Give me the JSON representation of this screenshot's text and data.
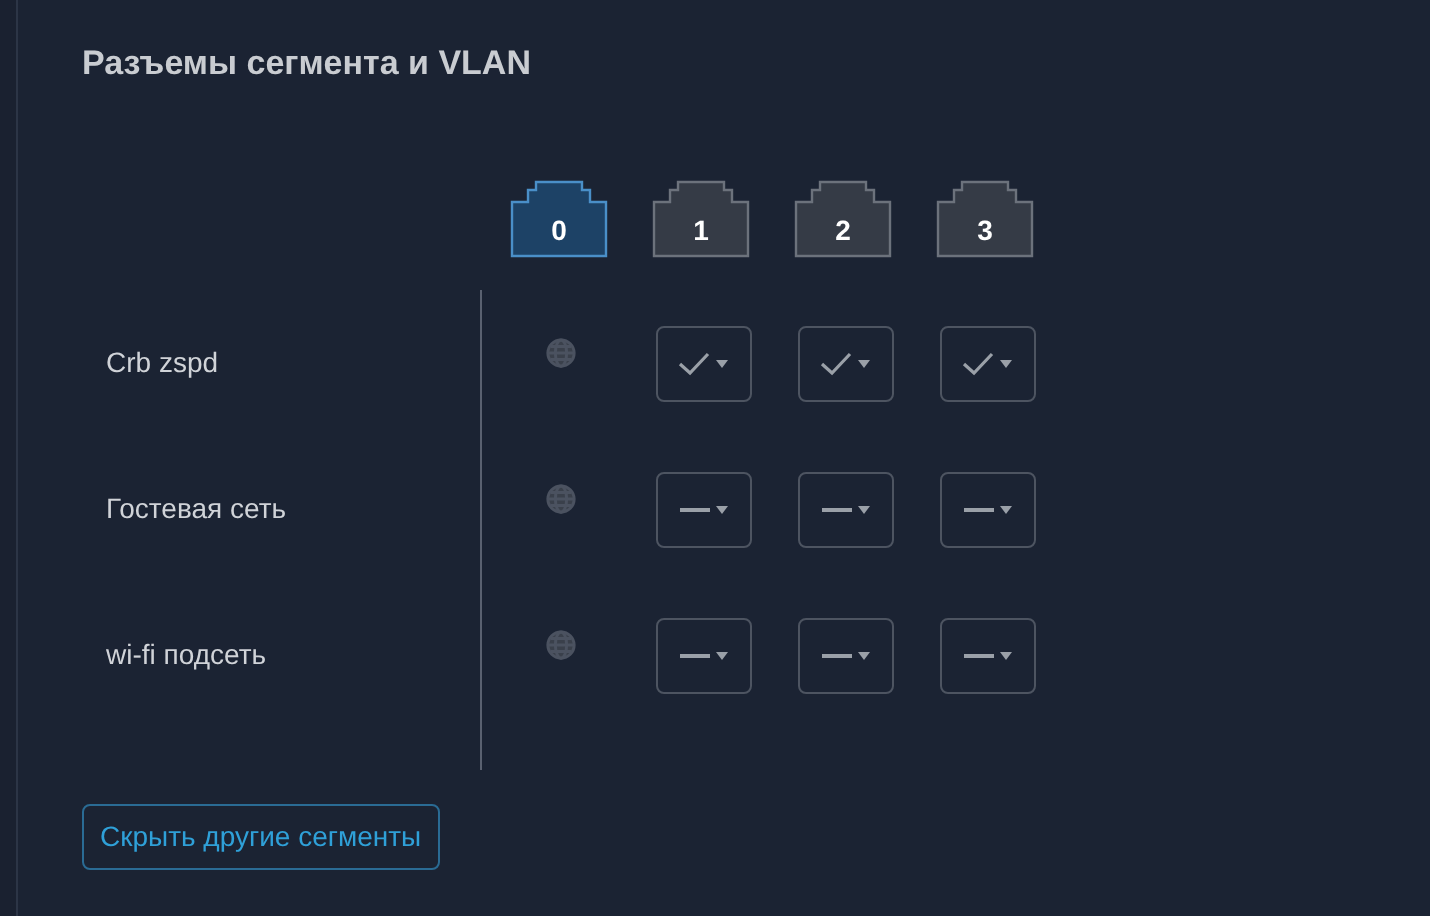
{
  "title": "Разъемы сегмента и VLAN",
  "ports": [
    {
      "label": "0",
      "selected": true
    },
    {
      "label": "1",
      "selected": false
    },
    {
      "label": "2",
      "selected": false
    },
    {
      "label": "3",
      "selected": false
    }
  ],
  "segments": [
    {
      "name": "Crb zspd",
      "cells": [
        {
          "kind": "globe"
        },
        {
          "kind": "check"
        },
        {
          "kind": "check"
        },
        {
          "kind": "check"
        }
      ]
    },
    {
      "name": "Гостевая сеть",
      "cells": [
        {
          "kind": "globe"
        },
        {
          "kind": "none"
        },
        {
          "kind": "none"
        },
        {
          "kind": "none"
        }
      ]
    },
    {
      "name": "wi-fi подсеть",
      "cells": [
        {
          "kind": "globe"
        },
        {
          "kind": "none"
        },
        {
          "kind": "none"
        },
        {
          "kind": "none"
        }
      ]
    }
  ],
  "hide_button": "Скрыть другие сегменты"
}
